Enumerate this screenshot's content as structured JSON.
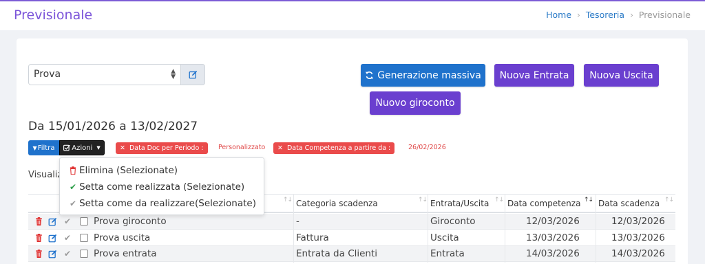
{
  "header": {
    "title": "Previsionale",
    "breadcrumb": [
      "Home",
      "Tesoreria",
      "Previsionale"
    ]
  },
  "selector": {
    "value": "Prova"
  },
  "buttons": {
    "generazione": "Generazione massiva",
    "nuova_entrata": "Nuova Entrata",
    "nuova_uscita": "Nuova Uscita",
    "nuovo_giroconto": "Nuovo giroconto"
  },
  "date_range": "Da 15/01/2026 a 13/02/2027",
  "toolbar": {
    "filtra": "Filtra",
    "azioni": "Azioni"
  },
  "filters": [
    {
      "label": "Data Doc per Periodo :",
      "value": "Personalizzato"
    },
    {
      "label": "Data Competenza a partire da :",
      "value": "26/02/2026"
    }
  ],
  "visualizza_label": "Visualizza",
  "dropdown": {
    "items": [
      {
        "label": "Elimina (Selezionate)",
        "icon": "trash-icon"
      },
      {
        "label": "Setta come realizzata (Selezionate)",
        "icon": "check-icon"
      },
      {
        "label": "Setta come da realizzare(Selezionate)",
        "icon": "check-icon"
      }
    ]
  },
  "table": {
    "columns": [
      "Categoria scadenza",
      "Entrata/Uscita",
      "Data competenza",
      "Data scadenza"
    ],
    "rows": [
      {
        "name": "Prova giroconto",
        "categoria": "-",
        "tipo": "Giroconto",
        "competenza": "12/03/2026",
        "scadenza": "12/03/2026"
      },
      {
        "name": "Prova uscita",
        "categoria": "Fattura",
        "tipo": "Uscita",
        "competenza": "13/03/2026",
        "scadenza": "13/03/2026"
      },
      {
        "name": "Prova entrata",
        "categoria": "Entrata da Clienti",
        "tipo": "Entrata",
        "competenza": "14/03/2026",
        "scadenza": "14/03/2026"
      }
    ]
  },
  "colors": {
    "accent_purple": "#6a3fcf",
    "accent_blue": "#1f72cc",
    "danger_red": "#ea4b4b",
    "success_green": "#2e9e4a"
  }
}
